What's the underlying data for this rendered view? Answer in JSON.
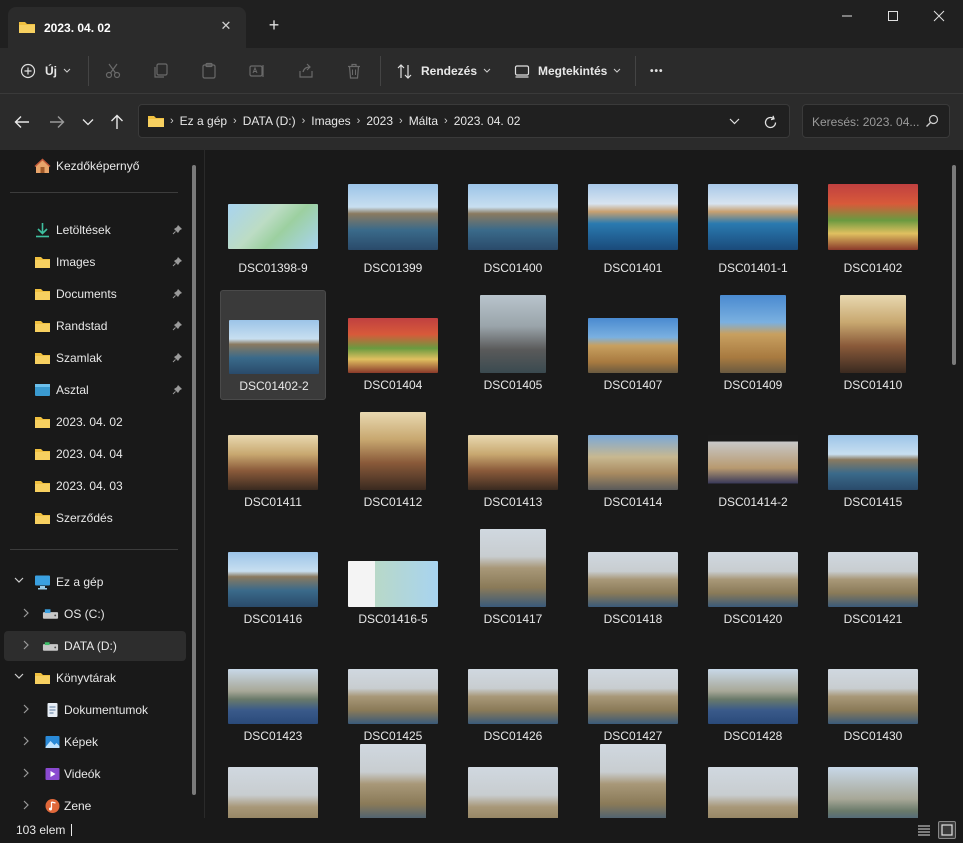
{
  "window": {
    "tab_title": "2023. 04. 02",
    "tab_close": "✕",
    "new_tab": "+"
  },
  "toolbar": {
    "new_label": "Új",
    "sort_label": "Rendezés",
    "view_label": "Megtekintés",
    "more_label": "•••"
  },
  "address": {
    "crumbs": [
      "Ez a gép",
      "DATA (D:)",
      "Images",
      "2023",
      "Málta",
      "2023. 04. 02"
    ],
    "separator": "›"
  },
  "search": {
    "placeholder": "Keresés: 2023. 04...."
  },
  "nav": {
    "home": "Kezdőképernyő",
    "quick": [
      {
        "label": "Letöltések",
        "icon": "download-icon"
      },
      {
        "label": "Images",
        "icon": "folder-icon"
      },
      {
        "label": "Documents",
        "icon": "folder-icon"
      },
      {
        "label": "Randstad",
        "icon": "folder-icon"
      },
      {
        "label": "Szamlak",
        "icon": "folder-icon"
      },
      {
        "label": "Asztal",
        "icon": "desktop-icon"
      }
    ],
    "recent": [
      "2023. 04. 02",
      "2023. 04. 04",
      "2023. 04. 03",
      "Szerződés"
    ],
    "this_pc": "Ez a gép",
    "drives": [
      "OS (C:)",
      "DATA (D:)"
    ],
    "libraries": "Könyvtárak",
    "library_items": [
      "Dokumentumok",
      "Képek",
      "Videók",
      "Zene"
    ]
  },
  "files": [
    "DSC01398-9",
    "DSC01399",
    "DSC01400",
    "DSC01401",
    "DSC01401-1",
    "DSC01402",
    "DSC01402-2",
    "DSC01404",
    "DSC01405",
    "DSC01407",
    "DSC01409",
    "DSC01410",
    "DSC01411",
    "DSC01412",
    "DSC01413",
    "DSC01414",
    "DSC01414-2",
    "DSC01415",
    "DSC01416",
    "DSC01416-5",
    "DSC01417",
    "DSC01418",
    "DSC01420",
    "DSC01421",
    "DSC01423",
    "DSC01425",
    "DSC01426",
    "DSC01427",
    "DSC01428",
    "DSC01430"
  ],
  "status": {
    "count": "103 elem"
  },
  "colors": {
    "folder": "#f0c040",
    "accent": "#4cc2ff"
  }
}
